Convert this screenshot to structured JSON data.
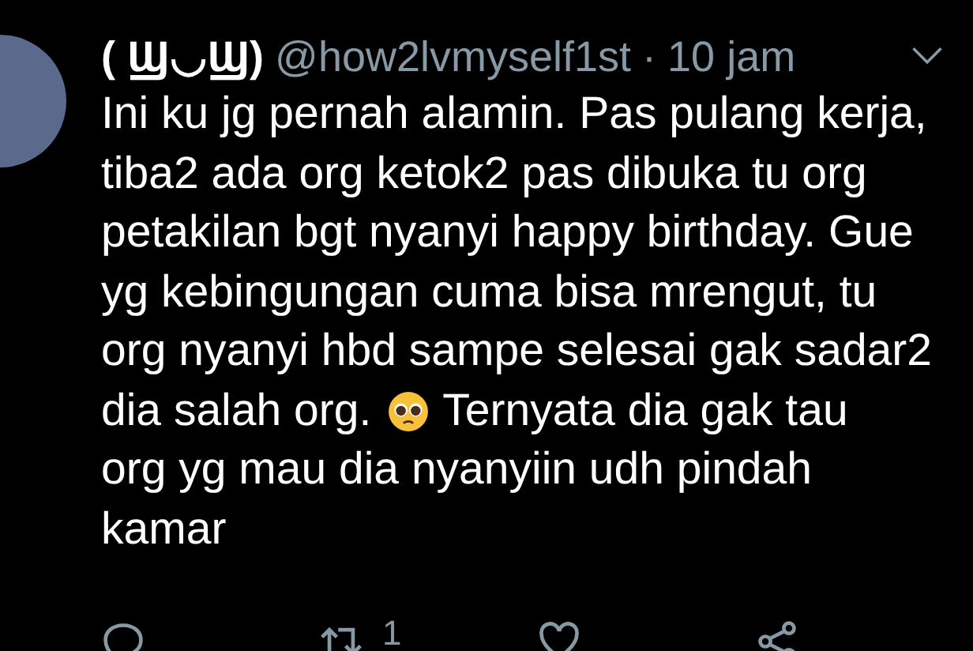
{
  "tweet": {
    "display_name": "( Ϣ◡Ϣ)",
    "handle": "@how2lvmyself1st",
    "separator": "·",
    "time": "10 jam",
    "lines": [
      {
        "kind": "text",
        "text": "Ini ku jg pernah alamin. Pas pulang kerja,"
      },
      {
        "kind": "text",
        "text": "tiba2 ada org ketok2 pas dibuka tu org"
      },
      {
        "kind": "text",
        "text": "petakilan bgt nyanyi happy birthday. Gue"
      },
      {
        "kind": "text",
        "text": "yg kebingungan  cuma bisa mrengut, tu"
      },
      {
        "kind": "text",
        "text": "org nyanyi hbd sampe selesai gak sadar2"
      },
      {
        "kind": "emoji",
        "before": "dia salah org.",
        "after": "Ternyata dia gak tau"
      },
      {
        "kind": "text",
        "text": "org yg mau dia nyanyiin udh pindah"
      },
      {
        "kind": "text",
        "text": "kamar"
      }
    ],
    "retweet_count": "1"
  }
}
